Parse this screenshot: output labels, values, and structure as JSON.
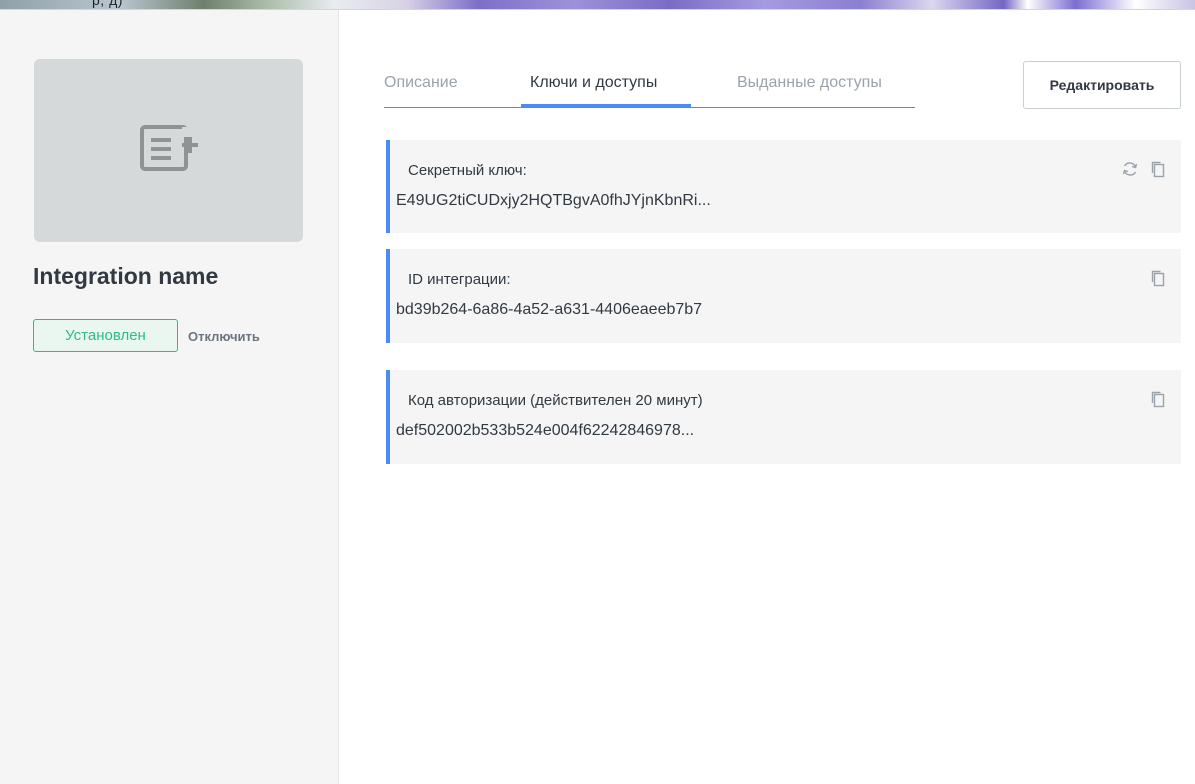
{
  "header_strip": {
    "text": "р, д)"
  },
  "integration": {
    "name": "Integration name",
    "status": "Установлен",
    "disable_label": "Отключить",
    "logo_icon": "add-list-icon"
  },
  "tabs": [
    {
      "label": "Описание",
      "active": false
    },
    {
      "label": "Ключи и доступы",
      "active": true
    },
    {
      "label": "Выданные доступы",
      "active": false
    }
  ],
  "edit_button": {
    "label": "Редактировать"
  },
  "cards": [
    {
      "label": "Секретный ключ:",
      "value": "E49UG2tiCUDxjy2HQTBgvA0fhJYjnKbnRi...",
      "icons": [
        "refresh-icon",
        "copy-icon"
      ]
    },
    {
      "label": "ID интеграции:",
      "value": "bd39b264-6a86-4a52-a631-4406eaeeb7b7",
      "icons": [
        "copy-icon"
      ]
    },
    {
      "label": "Код авторизации (действителен 20 минут)",
      "value": "def502002b533b524e004f62242846978...",
      "icons": [
        "copy-icon"
      ]
    }
  ],
  "colors": {
    "accent": "#4c8bf5",
    "success": "#2fbb84",
    "panel_bg": "#f5f5f5",
    "logo_bg": "#d5d9da"
  }
}
